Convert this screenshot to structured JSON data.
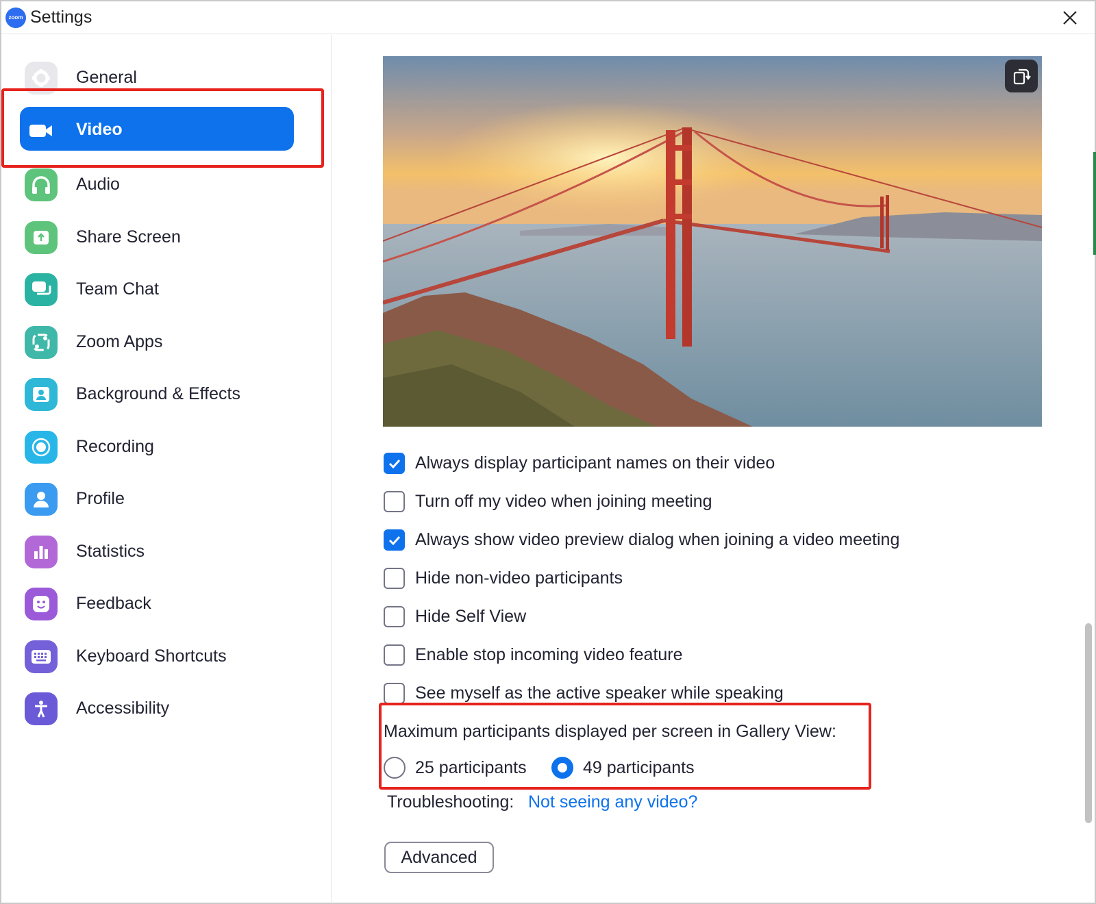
{
  "window": {
    "title": "Settings",
    "logo_text": "zoom"
  },
  "sidebar": {
    "items": [
      {
        "label": "General",
        "icon": "gear-icon",
        "color": "#e6e6ea"
      },
      {
        "label": "Video",
        "icon": "video-camera-icon",
        "color": "#0e72ed",
        "active": true
      },
      {
        "label": "Audio",
        "icon": "headphones-icon",
        "color": "#5ec47b"
      },
      {
        "label": "Share Screen",
        "icon": "share-screen-icon",
        "color": "#5ec47b"
      },
      {
        "label": "Team Chat",
        "icon": "chat-bubbles-icon",
        "color": "#2ab3a2"
      },
      {
        "label": "Zoom Apps",
        "icon": "apps-icon",
        "color": "#3fb8a9"
      },
      {
        "label": "Background & Effects",
        "icon": "background-icon",
        "color": "#2eb7d6"
      },
      {
        "label": "Recording",
        "icon": "record-icon",
        "color": "#28b6e8"
      },
      {
        "label": "Profile",
        "icon": "person-icon",
        "color": "#3a9bf0"
      },
      {
        "label": "Statistics",
        "icon": "bar-chart-icon",
        "color": "#b268d6"
      },
      {
        "label": "Feedback",
        "icon": "smiley-icon",
        "color": "#9b5ad8"
      },
      {
        "label": "Keyboard Shortcuts",
        "icon": "keyboard-icon",
        "color": "#7460d8"
      },
      {
        "label": "Accessibility",
        "icon": "accessibility-icon",
        "color": "#6a5ad8"
      }
    ]
  },
  "video": {
    "options": [
      {
        "label": "Always display participant names on their video",
        "checked": true
      },
      {
        "label": "Turn off my video when joining meeting",
        "checked": false
      },
      {
        "label": "Always show video preview dialog when joining a video meeting",
        "checked": true
      },
      {
        "label": "Hide non-video participants",
        "checked": false
      },
      {
        "label": "Hide Self View",
        "checked": false
      },
      {
        "label": "Enable stop incoming video feature",
        "checked": false
      },
      {
        "label": "See myself as the active speaker while speaking",
        "checked": false
      }
    ],
    "gallery": {
      "title": "Maximum participants displayed per screen in Gallery View:",
      "choices": [
        {
          "label": "25 participants",
          "checked": false
        },
        {
          "label": "49 participants",
          "checked": true
        }
      ]
    },
    "troubleshooting": {
      "label": "Troubleshooting:",
      "link": "Not seeing any video?"
    },
    "advanced_button": "Advanced"
  },
  "colors": {
    "accent": "#0e72ed",
    "highlight": "#e6231e"
  }
}
